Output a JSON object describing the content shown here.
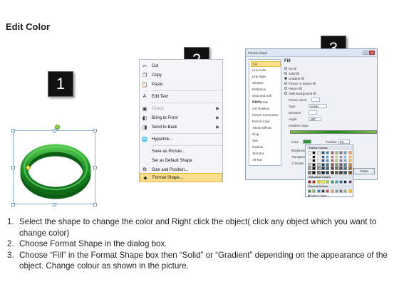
{
  "title": "Edit Color",
  "badges": [
    "1",
    "2",
    "3"
  ],
  "colors": {
    "ring": "#1e9e2a",
    "highlight": "#fbdf8c",
    "badge": "#111111"
  },
  "context_menu": {
    "items": [
      {
        "icon": "cut-icon",
        "label": "Cut",
        "disabled": false,
        "submenu": false
      },
      {
        "icon": "copy-icon",
        "label": "Copy",
        "disabled": false,
        "submenu": false
      },
      {
        "icon": "paste-icon",
        "label": "Paste",
        "disabled": false,
        "submenu": false
      },
      {
        "icon": "edit-text-icon",
        "label": "Edit Text",
        "disabled": false,
        "submenu": false
      },
      {
        "icon": "group-icon",
        "label": "Group",
        "disabled": true,
        "submenu": true
      },
      {
        "icon": "bring-front-icon",
        "label": "Bring to Front",
        "disabled": false,
        "submenu": true
      },
      {
        "icon": "send-back-icon",
        "label": "Send to Back",
        "disabled": false,
        "submenu": true
      },
      {
        "icon": "hyperlink-icon",
        "label": "Hyperlink...",
        "disabled": false,
        "submenu": false
      },
      {
        "icon": "",
        "label": "Save as Picture...",
        "disabled": false,
        "submenu": false
      },
      {
        "icon": "",
        "label": "Set as Default Shape",
        "disabled": false,
        "submenu": false
      },
      {
        "icon": "size-icon",
        "label": "Size and Position...",
        "disabled": false,
        "submenu": false
      },
      {
        "icon": "format-shape-icon",
        "label": "Format Shape...",
        "disabled": false,
        "submenu": false,
        "highlighted": true
      }
    ]
  },
  "dialog": {
    "title": "Format Shape",
    "categories": [
      "Fill",
      "Line Color",
      "Line Style",
      "Shadow",
      "Reflection",
      "Glow and Soft Edges",
      "3-D Format",
      "3-D Rotation",
      "Picture Corrections",
      "Picture Color",
      "Artistic Effects",
      "Crop",
      "Size",
      "Position",
      "Text Box",
      "Alt Text"
    ],
    "panel_heading": "Fill",
    "fill_options": [
      "No fill",
      "Solid fill",
      "Gradient fill",
      "Picture or texture fill",
      "Pattern fill",
      "Slide background fill"
    ],
    "labels": {
      "preset": "Preset colors:",
      "type": "Type:",
      "type_value": "Linear",
      "direction": "Direction:",
      "angle": "Angle:",
      "angle_value": "180°",
      "stops": "Gradient stops",
      "color": "Color",
      "position": "Position:",
      "position_value": "0%",
      "brightness": "Brightness:",
      "transparency": "Transparency:",
      "rotate": "Rotate with shape"
    },
    "close_label": "Close"
  },
  "palette": {
    "theme": "Theme Colors",
    "standard": "Standard Colors",
    "recent": "Recent Colors",
    "more": "More Colors..."
  },
  "instructions": [
    {
      "num": "1.",
      "text": "Select the shape to change the color and Right click the object( click any object which you want to change color)"
    },
    {
      "num": "2.",
      "text": "Choose Format Shape in the dialog box."
    },
    {
      "num": "3.",
      "text": "Choose “Fill” in the Format Shape box then “Solid” or “Gradient” depending on the appearance of the object. Change colour as shown in the picture."
    }
  ]
}
